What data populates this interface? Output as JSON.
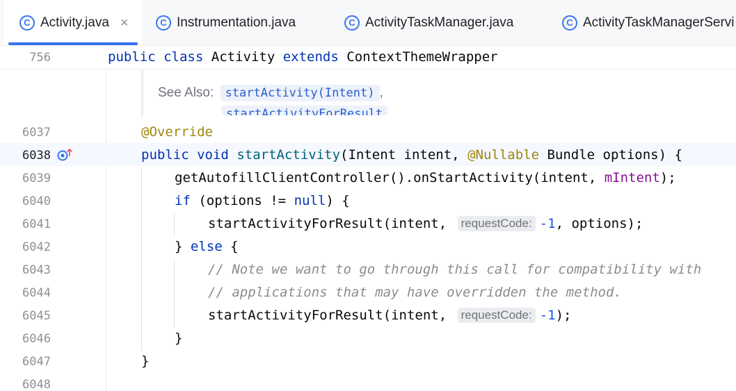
{
  "tabs": [
    {
      "label": "Activity.java",
      "active": true,
      "closable": true
    },
    {
      "label": "Instrumentation.java",
      "active": false
    },
    {
      "label": "ActivityTaskManager.java",
      "active": false
    },
    {
      "label": "ActivityTaskManagerServi",
      "active": false
    }
  ],
  "class_icon_glyph": "C",
  "close_glyph": "×",
  "sticky": {
    "line_number": "756",
    "kw1": "public",
    "kw2": "class",
    "name": "Activity",
    "kw3": "extends",
    "parent": "ContextThemeWrapper"
  },
  "doc": {
    "see_also": "See Also:",
    "link1": "startActivity(Intent)",
    "separator": ",",
    "link2": "startActivityForResult"
  },
  "line_numbers": [
    "6037",
    "6038",
    "6039",
    "6040",
    "6041",
    "6042",
    "6043",
    "6044",
    "6045",
    "6046",
    "6047",
    "6048"
  ],
  "code": {
    "l6037": {
      "ann": "@Override"
    },
    "l6038": {
      "kw1": "public",
      "kw2": "void",
      "method": "startActivity",
      "p1": "(Intent intent, ",
      "ann": "@Nullable",
      "p2": " Bundle options) {"
    },
    "l6039": {
      "text": "getAutofillClientController().onStartActivity(intent, ",
      "field": "mIntent",
      "tail": ");"
    },
    "l6040": {
      "kw": "if",
      "mid": " (options != ",
      "null": "null",
      "tail": ") {"
    },
    "l6041": {
      "text": "startActivityForResult(intent, ",
      "hint": "requestCode:",
      "num": "-1",
      "tail": ", options);"
    },
    "l6042": {
      "brace": "} ",
      "kw": "else",
      "tail": " {"
    },
    "l6043": {
      "comment": "// Note we want to go through this call for compatibility with"
    },
    "l6044": {
      "comment": "// applications that may have overridden the method."
    },
    "l6045": {
      "text": "startActivityForResult(intent, ",
      "hint": "requestCode:",
      "num": "-1",
      "tail": ");"
    },
    "l6046": {
      "text": "}"
    },
    "l6047": {
      "text": "}"
    }
  },
  "colors": {
    "keyword": "#0033b3",
    "annotation": "#9e880d",
    "field": "#871094",
    "number": "#1750eb",
    "comment": "#8c8c8c",
    "accent": "#3574f0"
  }
}
